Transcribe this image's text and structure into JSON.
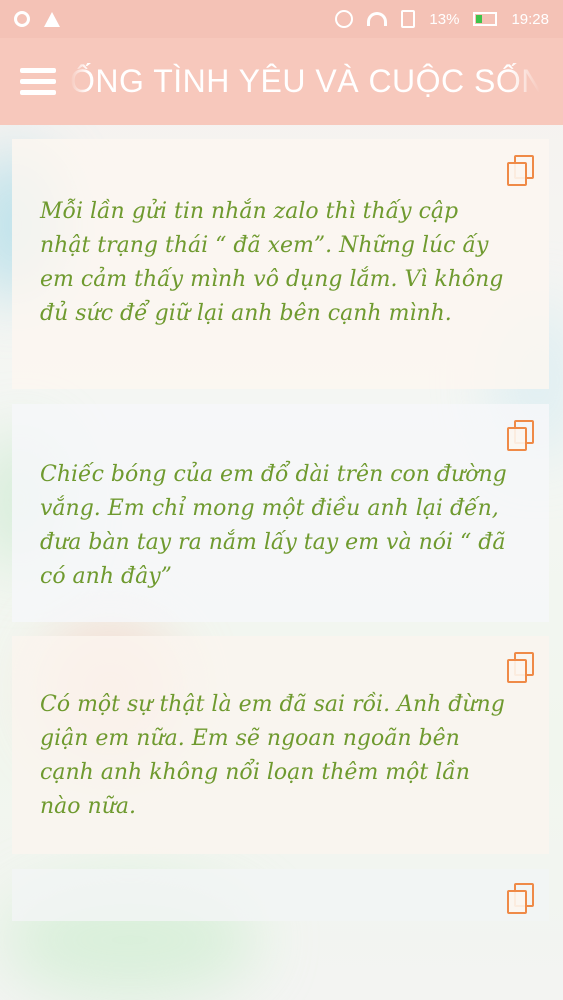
{
  "status_bar": {
    "battery": "13%",
    "time": "19:28",
    "icons": [
      "notification-icon",
      "warning-icon",
      "sync-icon",
      "wifi-icon",
      "sim-icon",
      "battery-icon"
    ]
  },
  "app_bar": {
    "title": "ỐNG TÌNH YÊU VÀ CUỘC SỐNG",
    "menu_icon": "hamburger-menu-icon"
  },
  "quotes": [
    {
      "text": "Mỗi lần gửi tin nhắn zalo thì thấy cập nhật trạng thái “ đã xem”. Những lúc ấy em cảm thấy mình vô dụng lắm. Vì không đủ sức để giữ lại anh bên cạnh mình.",
      "icon": "copy-icon"
    },
    {
      "text": "Chiếc bóng của em đổ dài trên con đường vắng. Em chỉ mong một điều anh lại đến, đưa bàn tay ra nắm lấy tay em và nói “ đã có anh đây”",
      "icon": "copy-icon"
    },
    {
      "text": "Có một sự thật là em đã sai rồi. Anh đừng giận em nữa. Em sẽ ngoan ngoãn bên cạnh anh không nổi loạn thêm một lần nào nữa.",
      "icon": "copy-icon"
    },
    {
      "text": "",
      "icon": "copy-icon"
    }
  ],
  "colors": {
    "app_bar": "#f7c8bc",
    "quote_text": "#6f9a2f",
    "copy_icon": "#ef8a47"
  }
}
